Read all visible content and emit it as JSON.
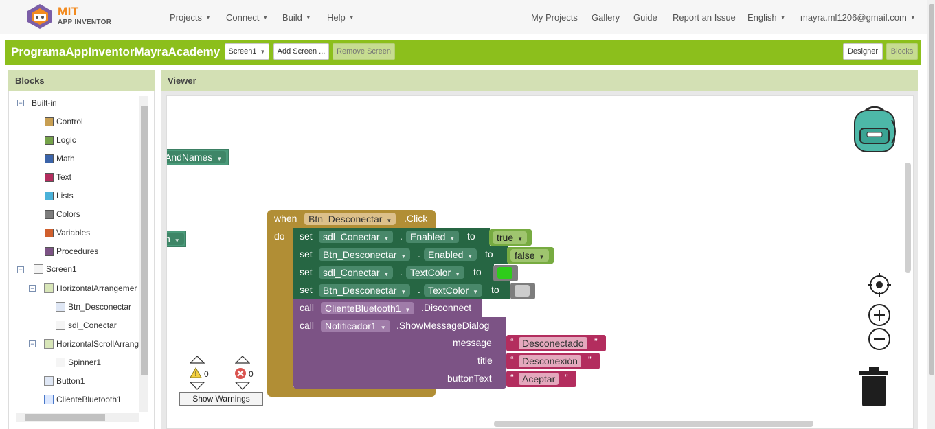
{
  "app": {
    "logo_top": "MIT",
    "logo_bottom": "APP INVENTOR"
  },
  "nav": {
    "left": [
      "Projects",
      "Connect",
      "Build",
      "Help"
    ],
    "right": [
      "My Projects",
      "Gallery",
      "Guide",
      "Report an Issue",
      "English",
      "mayra.ml1206@gmail.com"
    ]
  },
  "project": {
    "name": "ProgramaAppInventorMayraAcademy",
    "screen_select": "Screen1",
    "add_screen": "Add Screen ...",
    "remove_screen": "Remove Screen",
    "designer": "Designer",
    "blocks": "Blocks"
  },
  "panels": {
    "blocks_title": "Blocks",
    "viewer_title": "Viewer"
  },
  "tree": {
    "builtin_label": "Built-in",
    "builtin": [
      {
        "label": "Control",
        "color": "#c89f52"
      },
      {
        "label": "Logic",
        "color": "#75a34a"
      },
      {
        "label": "Math",
        "color": "#3b64a9"
      },
      {
        "label": "Text",
        "color": "#b32d5e"
      },
      {
        "label": "Lists",
        "color": "#4bb2d9"
      },
      {
        "label": "Colors",
        "color": "#7d7d7d"
      },
      {
        "label": "Variables",
        "color": "#d05f2d"
      },
      {
        "label": "Procedures",
        "color": "#7c5385"
      }
    ],
    "components": {
      "screen": "Screen1",
      "h_arrangement": "HorizontalArrangemer",
      "btn": "Btn_Desconectar",
      "sdl": "sdl_Conectar",
      "h_scroll": "HorizontalScrollArrang",
      "spinner": "Spinner1",
      "button1": "Button1",
      "bluetooth": "ClienteBluetooth1"
    }
  },
  "workspace": {
    "frag1": "AndNames",
    "frag2": "n",
    "event": {
      "when": "when",
      "component": "Btn_Desconectar",
      "event_name": ".Click",
      "do": "do"
    },
    "rows": [
      {
        "kw": "set",
        "comp": "sdl_Conectar",
        "prop": "Enabled",
        "to": "to",
        "val": "true"
      },
      {
        "kw": "set",
        "comp": "Btn_Desconectar",
        "prop": "Enabled",
        "to": "to",
        "val": "false"
      },
      {
        "kw": "set",
        "comp": "sdl_Conectar",
        "prop": "TextColor",
        "to": "to"
      },
      {
        "kw": "set",
        "comp": "Btn_Desconectar",
        "prop": "TextColor",
        "to": "to"
      }
    ],
    "dot": ".",
    "call1": {
      "kw": "call",
      "comp": "ClienteBluetooth1",
      "method": ".Disconnect"
    },
    "call2": {
      "kw": "call",
      "comp": "Notificador1",
      "method": ".ShowMessageDialog",
      "message_label": "message",
      "message": "Desconectado",
      "title_label": "title",
      "title": "Desconexión",
      "button_label": "buttonText",
      "button": "Aceptar"
    },
    "quote_open": "“",
    "quote_close": "”",
    "warnings_count": "0",
    "errors_count": "0",
    "show_warnings": "Show Warnings"
  },
  "colors": {
    "event": "#b18e35",
    "setter": "#266643",
    "logic": "#77ab41",
    "call": "#7c5385",
    "text": "#b32d5e",
    "green_swatch": "#2ecc1a",
    "gray_swatch": "#cccccc"
  }
}
